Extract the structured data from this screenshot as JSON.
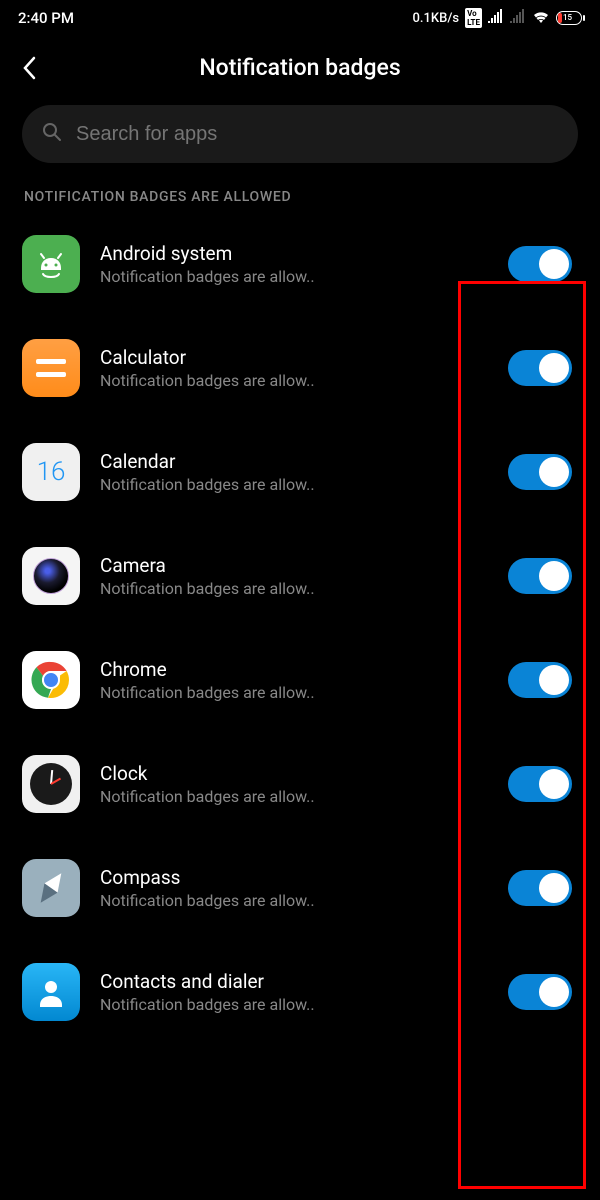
{
  "statusbar": {
    "time": "2:40 PM",
    "speed": "0.1KB/s",
    "battery": "15"
  },
  "header": {
    "title": "Notification badges"
  },
  "search": {
    "placeholder": "Search for apps"
  },
  "section": {
    "title": "NOTIFICATION BADGES ARE ALLOWED"
  },
  "apps": [
    {
      "name": "Android system",
      "sub": "Notification badges are allow.."
    },
    {
      "name": "Calculator",
      "sub": "Notification badges are allow.."
    },
    {
      "name": "Calendar",
      "sub": "Notification badges are allow.."
    },
    {
      "name": "Camera",
      "sub": "Notification badges are allow.."
    },
    {
      "name": "Chrome",
      "sub": "Notification badges are allow.."
    },
    {
      "name": "Clock",
      "sub": "Notification badges are allow.."
    },
    {
      "name": "Compass",
      "sub": "Notification badges are allow.."
    },
    {
      "name": "Contacts and dialer",
      "sub": "Notification badges are allow.."
    }
  ],
  "calendar_day": "16"
}
